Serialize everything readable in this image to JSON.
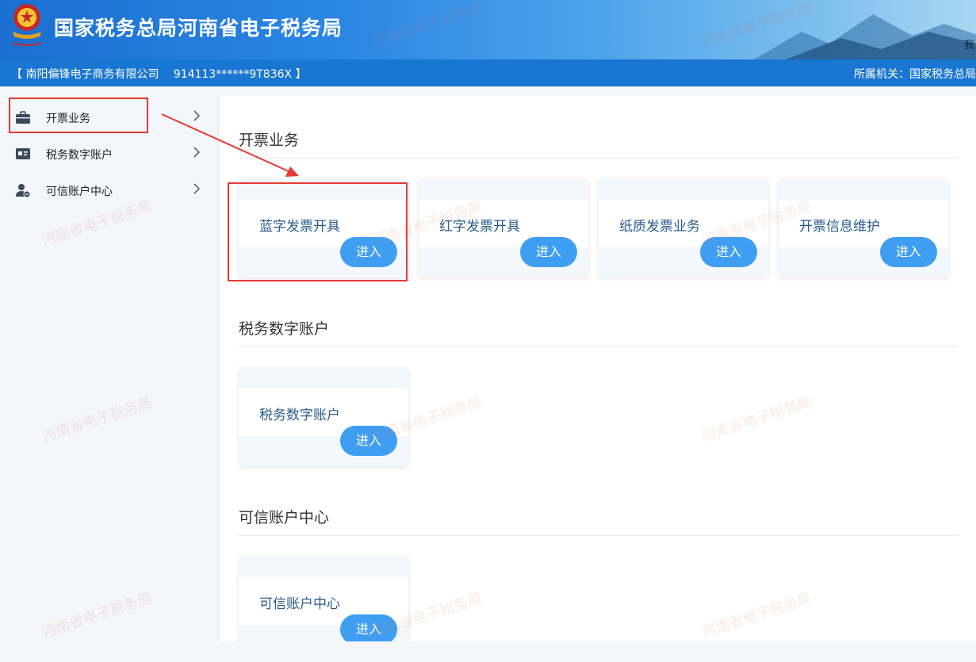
{
  "header": {
    "site_title": "国家税务总局河南省电子税务局",
    "cut_text": "我"
  },
  "infobar": {
    "company": "【 南阳偏锋电子商务有限公司　 914113******9T836X 】",
    "org": "所属机关：国家税务总局"
  },
  "sidebar": {
    "items": [
      {
        "label": "开票业务",
        "icon": "briefcase-icon"
      },
      {
        "label": "税务数字账户",
        "icon": "id-card-icon"
      },
      {
        "label": "可信账户中心",
        "icon": "user-shield-icon"
      }
    ]
  },
  "sections": [
    {
      "title": "开票业务",
      "cards": [
        {
          "title": "蓝字发票开具",
          "button": "进入"
        },
        {
          "title": "红字发票开具",
          "button": "进入"
        },
        {
          "title": "纸质发票业务",
          "button": "进入"
        },
        {
          "title": "开票信息维护",
          "button": "进入"
        }
      ]
    },
    {
      "title": "税务数字账户",
      "cards": [
        {
          "title": "税务数字账户",
          "button": "进入"
        }
      ]
    },
    {
      "title": "可信账户中心",
      "cards": [
        {
          "title": "可信账户中心",
          "button": "进入"
        }
      ]
    }
  ],
  "watermark": "河南省电子税务局",
  "colors": {
    "header_blue": "#1976d2",
    "button_blue": "#3f9ef2",
    "highlight_red": "#e53935"
  }
}
